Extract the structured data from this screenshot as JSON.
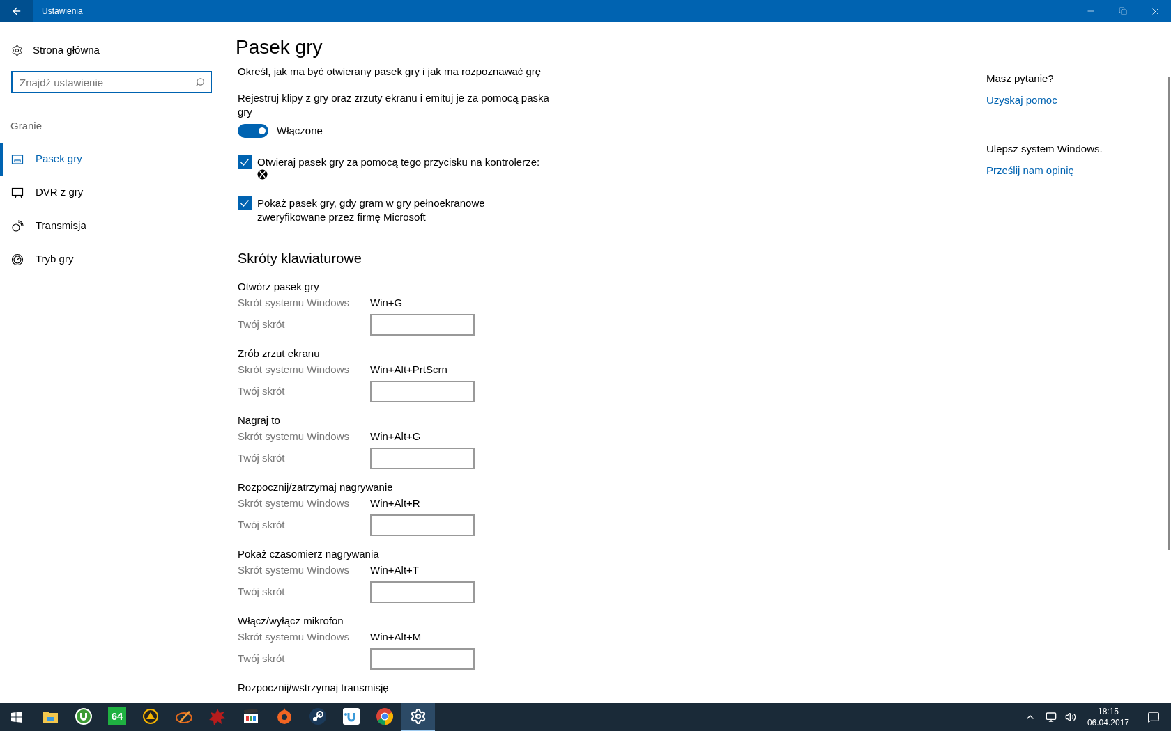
{
  "window": {
    "title": "Ustawienia"
  },
  "sidebar": {
    "home": "Strona główna",
    "search": {
      "placeholder": "Znajdź ustawienie"
    },
    "section": "Granie",
    "items": [
      {
        "label": "Pasek gry",
        "kind": "bar",
        "selected": true
      },
      {
        "label": "DVR z gry",
        "kind": "dvr",
        "selected": false
      },
      {
        "label": "Transmisja",
        "kind": "broadcast",
        "selected": false
      },
      {
        "label": "Tryb gry",
        "kind": "gauge",
        "selected": false
      }
    ]
  },
  "page": {
    "title": "Pasek gry",
    "description": "Określ, jak ma być otwierany pasek gry i jak ma rozpoznawać grę",
    "record": {
      "label": "Rejestruj klipy z gry oraz zrzuty ekranu i emituj je za pomocą paska gry",
      "on": true,
      "state_text": "Włączone"
    },
    "checkboxes": [
      {
        "label": "Otwieraj pasek gry za pomocą tego przycisku na kontrolerze:",
        "checked": true,
        "kind": "controller"
      },
      {
        "label": "Pokaż pasek gry, gdy gram w gry pełnoekranowe zweryfikowane przez firmę Microsoft",
        "checked": true,
        "kind": "plain"
      }
    ],
    "shortcuts_heading": "Skróty klawiaturowe",
    "shortcuts": [
      {
        "name": "Otwórz pasek gry",
        "system_label": "Skrót systemu Windows",
        "system_value": "Win+G",
        "custom_label": "Twój skrót"
      },
      {
        "name": "Zrób zrzut ekranu",
        "system_label": "Skrót systemu Windows",
        "system_value": "Win+Alt+PrtScrn",
        "custom_label": "Twój skrót"
      },
      {
        "name": "Nagraj to",
        "system_label": "Skrót systemu Windows",
        "system_value": "Win+Alt+G",
        "custom_label": "Twój skrót"
      },
      {
        "name": "Rozpocznij/zatrzymaj nagrywanie",
        "system_label": "Skrót systemu Windows",
        "system_value": "Win+Alt+R",
        "custom_label": "Twój skrót"
      },
      {
        "name": "Pokaż czasomierz nagrywania",
        "system_label": "Skrót systemu Windows",
        "system_value": "Win+Alt+T",
        "custom_label": "Twój skrót"
      },
      {
        "name": "Włącz/wyłącz mikrofon",
        "system_label": "Skrót systemu Windows",
        "system_value": "Win+Alt+M",
        "custom_label": "Twój skrót"
      },
      {
        "name": "Rozpocznij/wstrzymaj transmisję"
      }
    ]
  },
  "help": [
    {
      "heading": "Masz pytanie?",
      "link": "Uzyskaj pomoc"
    },
    {
      "heading": "Ulepsz system Windows.",
      "link": "Prześlij nam opinię"
    }
  ],
  "taskbar": {
    "apps": [
      {
        "kind": "folder",
        "selected": false
      },
      {
        "kind": "torrent",
        "selected": false
      },
      {
        "kind": "green",
        "text": "64",
        "selected": false
      },
      {
        "kind": "triangle",
        "selected": false
      },
      {
        "kind": "pencil",
        "selected": false
      },
      {
        "kind": "splash",
        "selected": false
      },
      {
        "kind": "clapper",
        "selected": false
      },
      {
        "kind": "orange",
        "selected": false
      },
      {
        "kind": "steam",
        "selected": false
      },
      {
        "kind": "uplay",
        "selected": false
      },
      {
        "kind": "chrome",
        "selected": false
      },
      {
        "kind": "gear",
        "selected": true
      }
    ],
    "time": "18:15",
    "date": "06.04.2017"
  }
}
